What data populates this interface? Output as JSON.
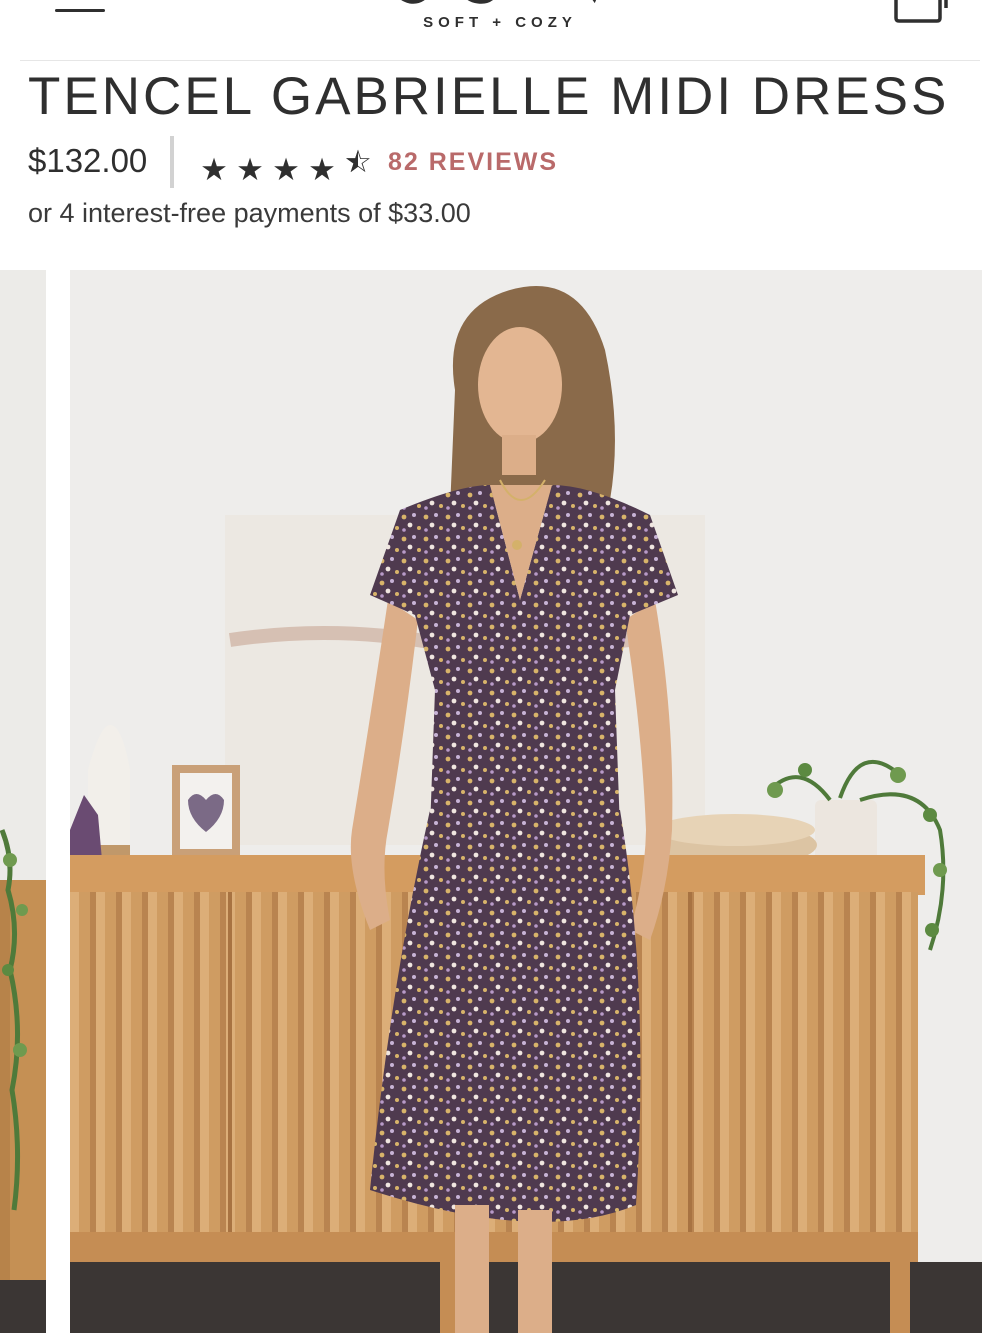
{
  "header": {
    "menu_icon": "hamburger-menu-icon",
    "logo_tagline": "SOFT + COZY",
    "cart_icon": "shopping-bag-icon"
  },
  "product": {
    "title": "TENCEL GABRIELLE MIDI DRESS",
    "price": "$132.00",
    "rating": 4.5,
    "rating_max": 5,
    "reviews_label": "82 REVIEWS",
    "installments": "or 4 interest-free payments of $33.00"
  },
  "gallery": {
    "active_image": "model-in-floral-midi-dress-photo"
  },
  "colors": {
    "text": "#2f2f2f",
    "reviews_accent": "#b96a6a",
    "wall": "#eeedeb",
    "wood": "#c8945a",
    "dress": "#5b4458"
  }
}
